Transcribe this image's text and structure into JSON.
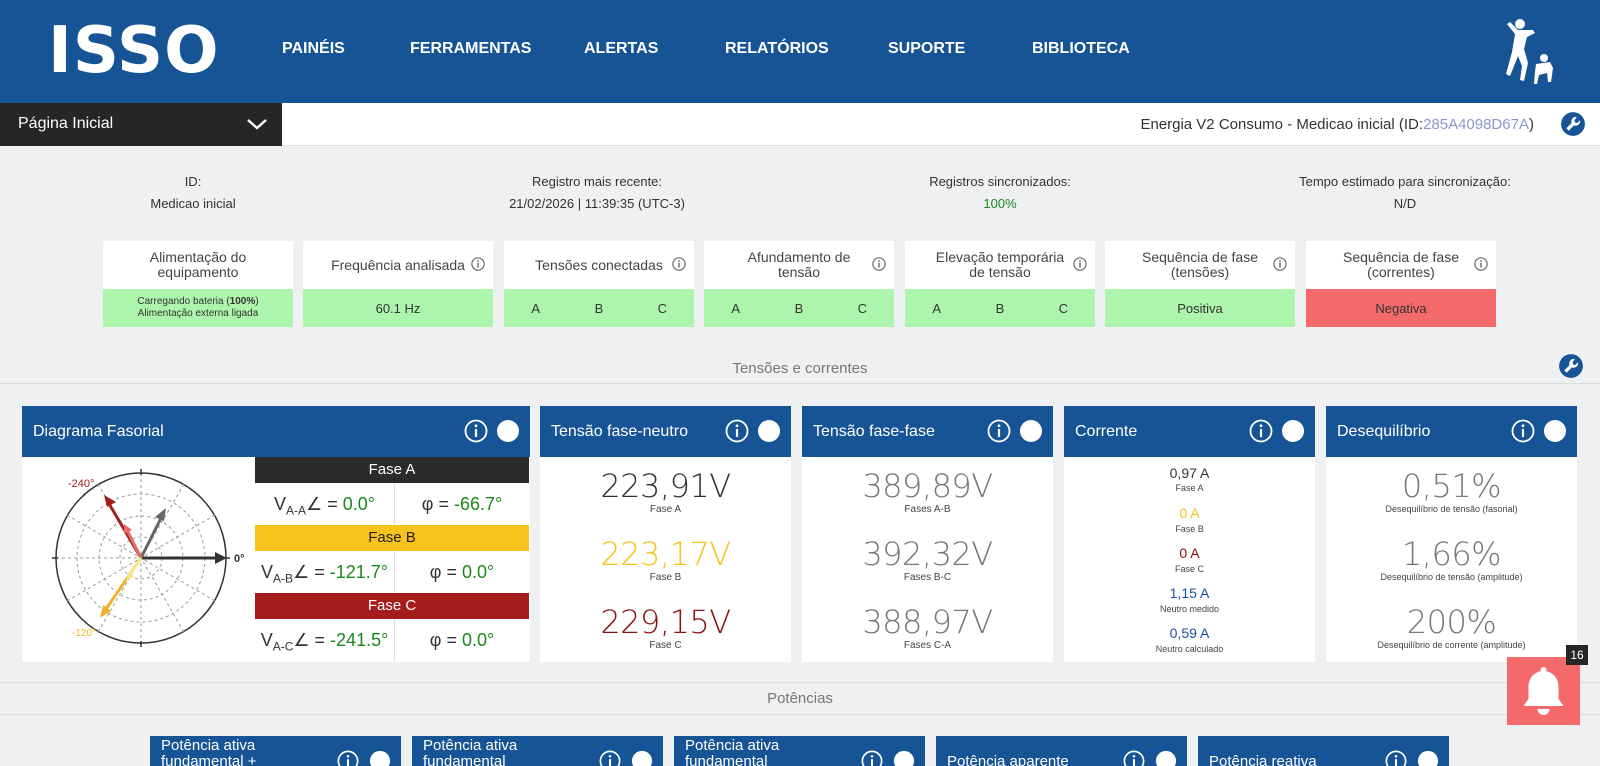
{
  "header": {
    "logo": "ISSO",
    "nav": [
      "PAINÉIS",
      "FERRAMENTAS",
      "ALERTAS",
      "RELATÓRIOS",
      "SUPORTE",
      "BIBLIOTECA"
    ]
  },
  "subbar": {
    "page_select": "Página Inicial",
    "device_prefix": "Energia V2 Consumo - Medicao inicial (ID:",
    "device_id": "285A4098D67A",
    "device_suffix": ")"
  },
  "info": [
    {
      "label": "ID:",
      "value": "Medicao inicial"
    },
    {
      "label": "Registro mais recente:",
      "value": "21/02/2026 | 11:39:35 (UTC-3)"
    },
    {
      "label": "Registros sincronizados:",
      "value": "100%"
    },
    {
      "label": "Tempo estimado para sincronização:",
      "value": "N/D"
    }
  ],
  "status_cards": [
    {
      "title": "Alimentação do equipamento",
      "line1_pre": "Carregando bateria (",
      "line1_bold": "100%",
      "line1_post": ")",
      "line2": "Alimentação externa ligada"
    },
    {
      "title": "Frequência analisada",
      "value": "60.1 Hz"
    },
    {
      "title": "Tensões conectadas",
      "phases": [
        "A",
        "B",
        "C"
      ]
    },
    {
      "title": "Afundamento de tensão",
      "phases": [
        "A",
        "B",
        "C"
      ]
    },
    {
      "title": "Elevação temporária de tensão",
      "phases": [
        "A",
        "B",
        "C"
      ]
    },
    {
      "title": "Sequência de fase (tensões)",
      "value": "Positiva"
    },
    {
      "title": "Sequência de fase (correntes)",
      "value": "Negativa"
    }
  ],
  "section1": "Tensões e correntes",
  "section2": "Potências",
  "phasor": {
    "title": "Diagrama Fasorial",
    "label_m240": "-240°",
    "label_0": "0°",
    "label_m120": "-120°",
    "phases": [
      {
        "name": "Fase A",
        "v_main": "V",
        "v_sub": "A-A",
        "angle": "∠ = ",
        "angle_val": "0.0°",
        "phi": "φ = ",
        "phi_val": "-66.7°"
      },
      {
        "name": "Fase B",
        "v_main": "V",
        "v_sub": "A-B",
        "angle": "∠ = ",
        "angle_val": "-121.7°",
        "phi": "φ = ",
        "phi_val": "0.0°"
      },
      {
        "name": "Fase C",
        "v_main": "V",
        "v_sub": "A-C",
        "angle": "∠ = ",
        "angle_val": "-241.5°",
        "phi": "φ = ",
        "phi_val": "0.0°"
      }
    ]
  },
  "panels": {
    "tensao_fn": {
      "title": "Tensão fase-neutro",
      "values": [
        {
          "v": "223,91V",
          "l": "Fase A"
        },
        {
          "v": "223,17V",
          "l": "Fase B"
        },
        {
          "v": "229,15V",
          "l": "Fase C"
        }
      ]
    },
    "tensao_ff": {
      "title": "Tensão fase-fase",
      "values": [
        {
          "v": "389,89V",
          "l": "Fases A-B"
        },
        {
          "v": "392,32V",
          "l": "Fases B-C"
        },
        {
          "v": "388,97V",
          "l": "Fases C-A"
        }
      ]
    },
    "corrente": {
      "title": "Corrente",
      "values": [
        {
          "v": "0,97 A",
          "l": "Fase A"
        },
        {
          "v": "0 A",
          "l": "Fase B"
        },
        {
          "v": "0 A",
          "l": "Fase C"
        },
        {
          "v": "1,15 A",
          "l": "Neutro medido"
        },
        {
          "v": "0,59 A",
          "l": "Neutro calculado"
        }
      ]
    },
    "deseq": {
      "title": "Desequilíbrio",
      "values": [
        {
          "v": "0,51%",
          "l": "Desequilíbrio de tensão (fasorial)"
        },
        {
          "v": "1,66%",
          "l": "Desequilíbrio de tensão (amplitude)"
        },
        {
          "v": "200%",
          "l": "Desequilíbrio de corrente (amplitude)"
        }
      ]
    }
  },
  "bottom_panels": [
    {
      "l1": "Potência ativa",
      "l2": "fundamental +"
    },
    {
      "l1": "Potência ativa",
      "l2": "fundamental"
    },
    {
      "l1": "Potência ativa",
      "l2": "fundamental"
    },
    {
      "l1": "Potência aparente",
      "l2": ""
    },
    {
      "l1": "Potência reativa",
      "l2": ""
    }
  ],
  "notifications": {
    "count": "16"
  },
  "colors": {
    "header": "#165495",
    "ok": "#adf5ad",
    "bad": "#f46a6a",
    "phaseA": "#333333",
    "phaseB": "#f7c21c",
    "phaseC": "#a51c1c"
  }
}
